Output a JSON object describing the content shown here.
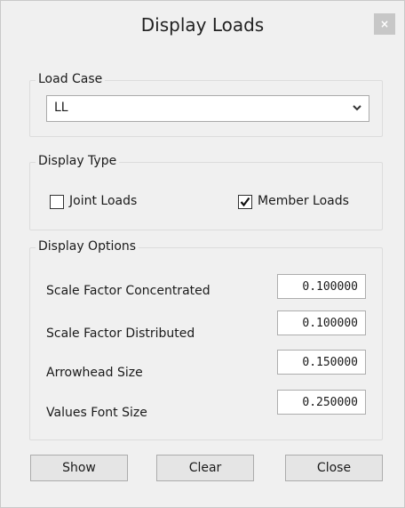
{
  "window": {
    "title": "Display Loads",
    "close_glyph": "×"
  },
  "load_case": {
    "legend": "Load Case",
    "selected": "LL"
  },
  "display_type": {
    "legend": "Display Type",
    "joint_loads": {
      "label": "Joint Loads",
      "checked": false
    },
    "member_loads": {
      "label": "Member Loads",
      "checked": true
    }
  },
  "display_options": {
    "legend": "Display Options",
    "scale_concentrated": {
      "label": "Scale Factor Concentrated",
      "value": "0.100000"
    },
    "scale_distributed": {
      "label": "Scale Factor Distributed",
      "value": "0.100000"
    },
    "arrowhead_size": {
      "label": "Arrowhead Size",
      "value": "0.150000"
    },
    "values_font_size": {
      "label": "Values Font Size",
      "value": "0.250000"
    }
  },
  "buttons": {
    "show": "Show",
    "clear": "Clear",
    "close": "Close"
  },
  "icons": {
    "close": "close-icon",
    "dropdown": "chevron-down-icon",
    "check": "checkmark-icon"
  }
}
